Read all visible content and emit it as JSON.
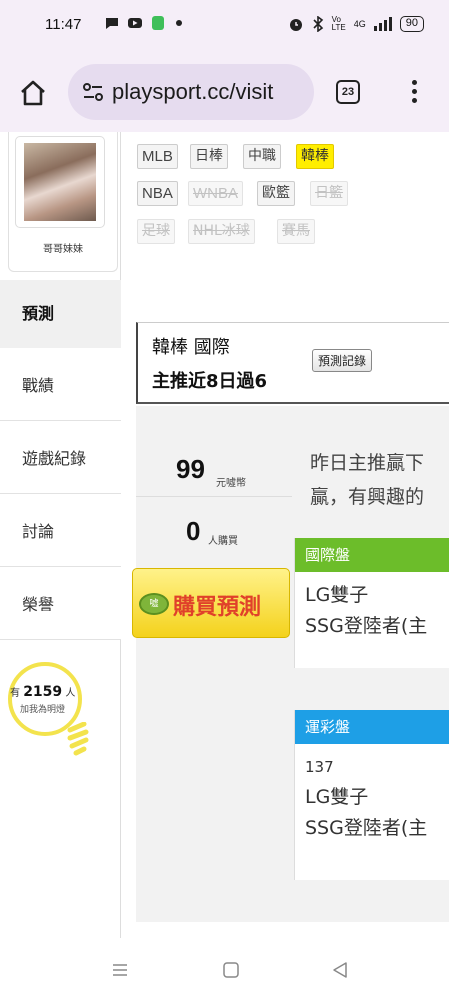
{
  "status_bar": {
    "time": "11:47",
    "network": "4G",
    "battery": "90"
  },
  "browser": {
    "url": "playsport.cc/visit",
    "tab_count": "23"
  },
  "profile": {
    "name": "哥哥妹妹"
  },
  "sport_tags": [
    {
      "label": "MLB",
      "state": "normal"
    },
    {
      "label": "日棒",
      "state": "normal"
    },
    {
      "label": "中職",
      "state": "normal"
    },
    {
      "label": "韓棒",
      "state": "active"
    },
    {
      "label": "NBA",
      "state": "normal"
    },
    {
      "label": "WNBA",
      "state": "disabled"
    },
    {
      "label": "歐籃",
      "state": "normal"
    },
    {
      "label": "日籃",
      "state": "disabled"
    },
    {
      "label": "足球",
      "state": "disabled"
    },
    {
      "label": "NHL冰球",
      "state": "disabled"
    },
    {
      "label": "賽馬",
      "state": "disabled"
    }
  ],
  "sidebar": {
    "items": [
      {
        "label": "預測"
      },
      {
        "label": "戰績"
      },
      {
        "label": "遊戲紀錄"
      },
      {
        "label": "討論"
      },
      {
        "label": "榮譽"
      }
    ],
    "fans": {
      "prefix": "有",
      "count": "2159",
      "suffix": "人",
      "caption": "加我為明燈"
    }
  },
  "header": {
    "title": "韓棒 國際",
    "subtitle": "主推近8日過6",
    "record_button": "預測記錄"
  },
  "stats": {
    "price": "99",
    "price_unit": "元噓幣",
    "buyers": "0",
    "buyers_unit": "人購買",
    "buy_button": "購買預測",
    "coin_label": "噓"
  },
  "description": {
    "line1": "昨日主推贏下",
    "line2": "贏，有興趣的"
  },
  "cards": [
    {
      "title": "國際盤",
      "color": "#6cbd2a",
      "lines": [
        "LG雙子",
        "SSG登陸者(主"
      ]
    },
    {
      "title": "運彩盤",
      "color": "#1e9fe6",
      "number": "137",
      "lines": [
        "LG雙子",
        "SSG登陸者(主"
      ]
    }
  ],
  "colors": {
    "active_tag": "#ffee00",
    "buy_button": "#f4d21c",
    "buy_text": "#e0412a",
    "bulb": "#f3e34d"
  }
}
